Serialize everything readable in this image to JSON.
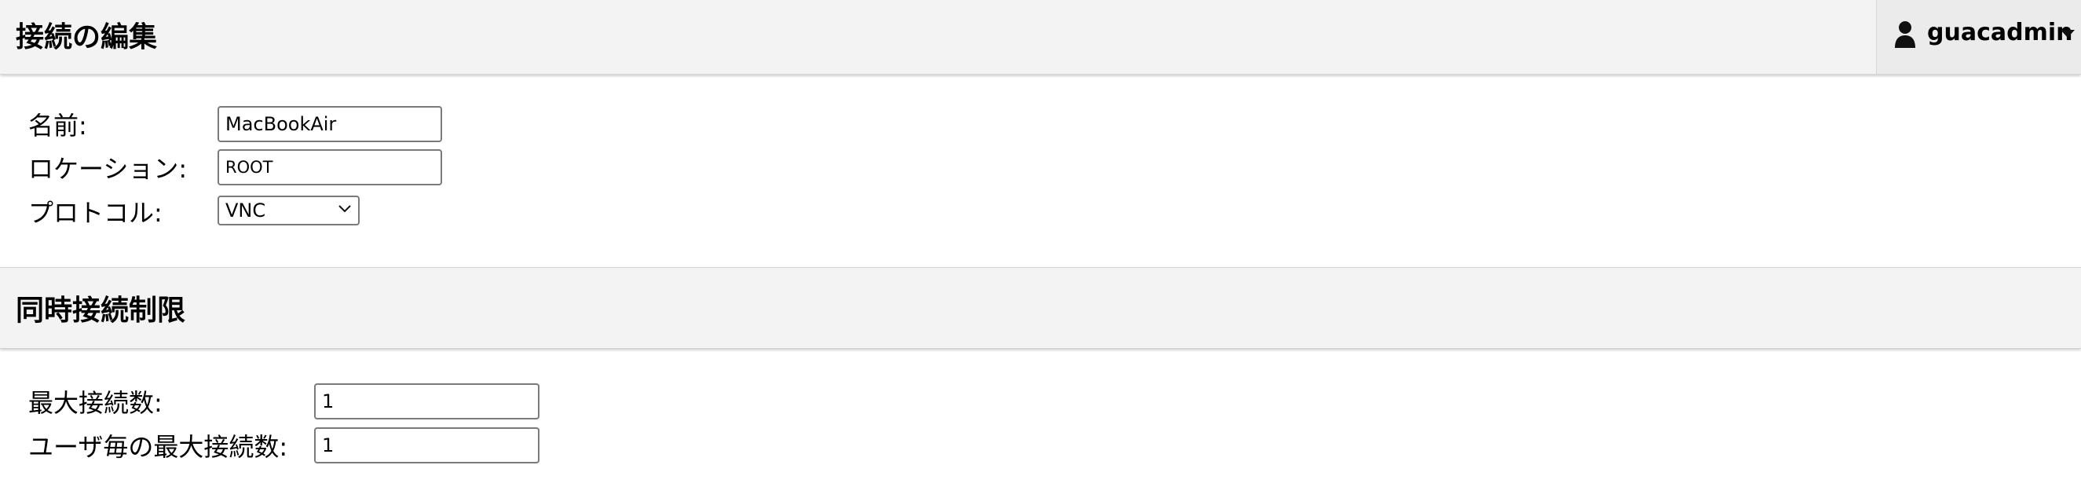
{
  "header": {
    "title": "接続の編集",
    "user": {
      "name": "guacadmin",
      "icon": "user-icon"
    }
  },
  "form": {
    "name_label": "名前:",
    "name_value": "MacBookAir",
    "location_label": "ロケーション:",
    "location_value": "ROOT",
    "protocol_label": "プロトコル:",
    "protocol_value": "VNC"
  },
  "limits": {
    "title": "同時接続制限",
    "max_connections_label": "最大接続数:",
    "max_connections_value": "1",
    "max_per_user_label": "ユーザ毎の最大接続数:",
    "max_per_user_value": "1"
  }
}
